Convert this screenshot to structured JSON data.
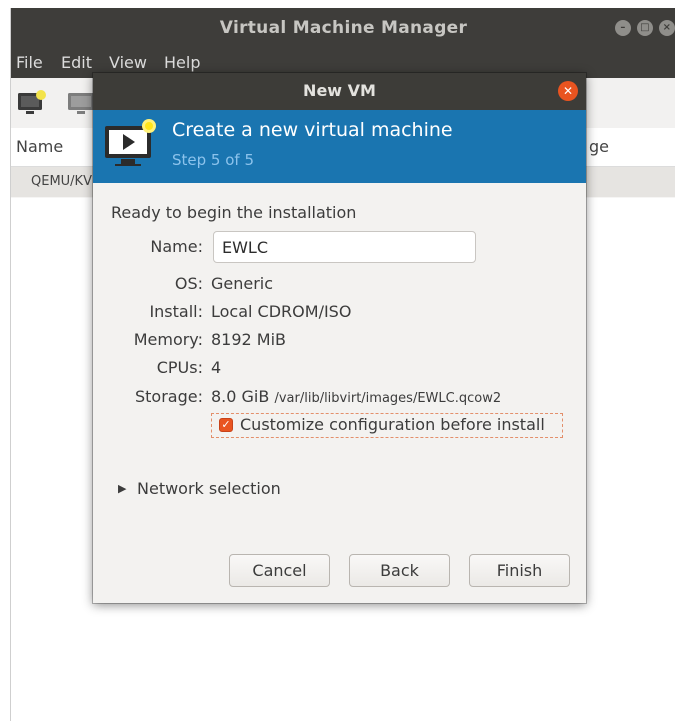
{
  "main_window": {
    "title": "Virtual Machine Manager",
    "menu": [
      "File",
      "Edit",
      "View",
      "Help"
    ],
    "columns": {
      "name": "Name",
      "usage_partial": "ge"
    },
    "connection_row": "QEMU/KV"
  },
  "dialog": {
    "title": "New VM",
    "header": {
      "title": "Create a new virtual machine",
      "step": "Step 5 of 5"
    },
    "ready_text": "Ready to begin the installation",
    "fields": {
      "name_label": "Name:",
      "name_value": "EWLC",
      "os_label": "OS:",
      "os_value": "Generic",
      "install_label": "Install:",
      "install_value": "Local CDROM/ISO",
      "memory_label": "Memory:",
      "memory_value": "8192 MiB",
      "cpus_label": "CPUs:",
      "cpus_value": "4",
      "storage_label": "Storage:",
      "storage_size": "8.0 GiB",
      "storage_path": "/var/lib/libvirt/images/EWLC.qcow2"
    },
    "customize": {
      "label": "Customize configuration before install",
      "checked": true
    },
    "network_expander": "Network selection",
    "buttons": {
      "cancel": "Cancel",
      "back": "Back",
      "finish": "Finish"
    }
  },
  "colors": {
    "accent": "#E95420",
    "banner": "#1A75B0",
    "titlebar": "#3D3C38"
  },
  "icons": [
    "new-vm-icon",
    "open-console-icon",
    "monitor-sparkle-icon",
    "close-icon",
    "check-icon",
    "expander-arrow-icon"
  ]
}
